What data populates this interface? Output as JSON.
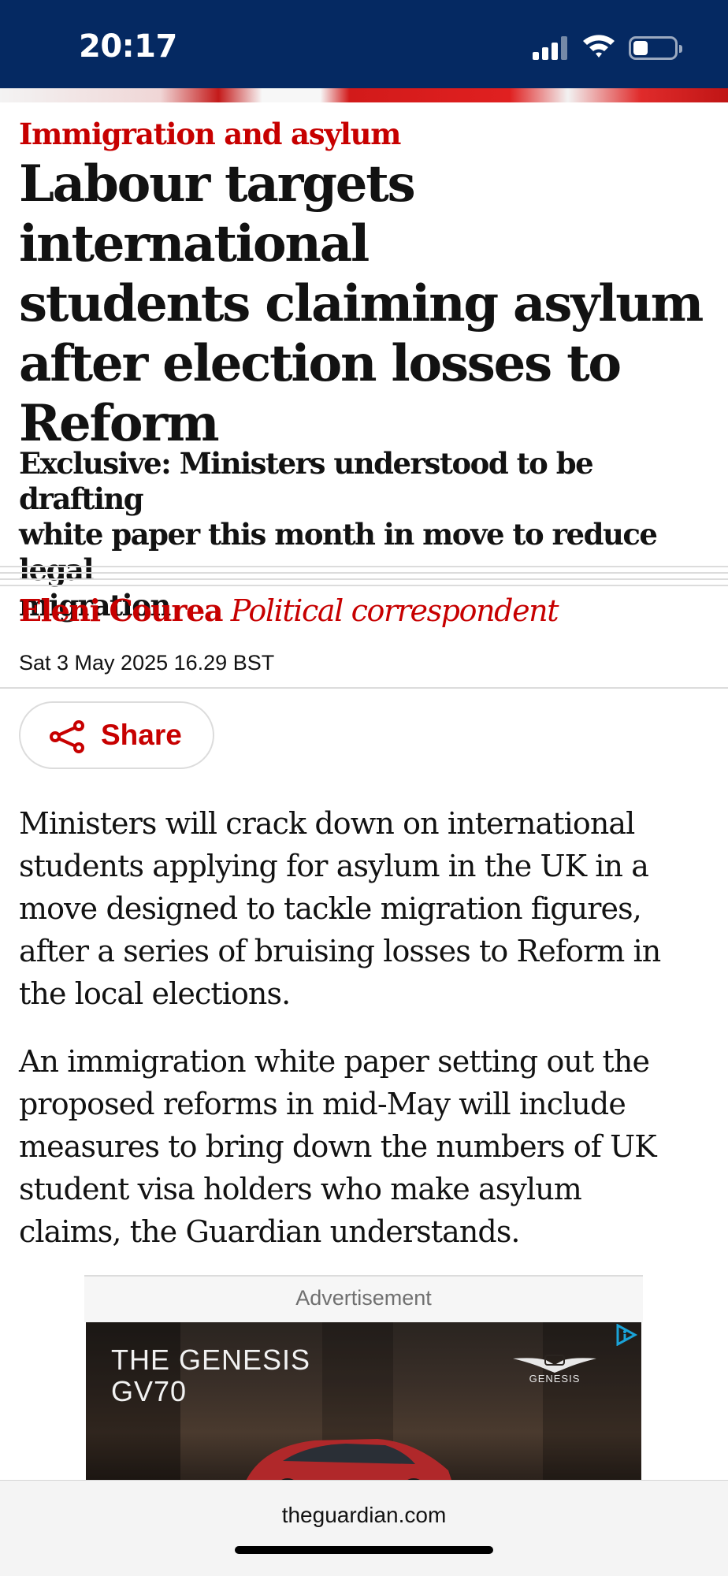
{
  "status_bar": {
    "time": "20:17",
    "background_color": "#052962",
    "icons": [
      "cellular-signal-icon",
      "wifi-icon",
      "battery-icon"
    ]
  },
  "article": {
    "kicker": "Immigration and asylum",
    "headline_lines": [
      "Labour targets international",
      "students claiming asylum",
      "after election losses to",
      "Reform"
    ],
    "standfirst_lines": [
      "Exclusive: Ministers understood to be drafting",
      "white paper this month in move to reduce legal",
      "migration"
    ],
    "byline": {
      "name": "Eleni Courea",
      "role": "Political correspondent"
    },
    "date": "Sat 3 May 2025 16.29 BST",
    "share_label": "Share",
    "paragraphs": [
      [
        "Ministers will crack down on international",
        "students applying for asylum in the UK in a",
        "move designed to tackle migration figures,",
        "after a series of bruising losses to Reform in",
        "the local elections."
      ],
      [
        "An immigration white paper setting out the",
        "proposed reforms in mid-May will include",
        "measures to bring down the numbers of UK",
        "student visa holders who make asylum",
        "claims, the Guardian understands."
      ]
    ],
    "accent_color": "#c70000"
  },
  "advertisement": {
    "label": "Advertisement",
    "title_line1": "THE GENESIS",
    "title_line2": "GV70",
    "brand": "GENESIS",
    "adchoices_icon": "adchoices-icon"
  },
  "browser": {
    "url": "theguardian.com"
  }
}
